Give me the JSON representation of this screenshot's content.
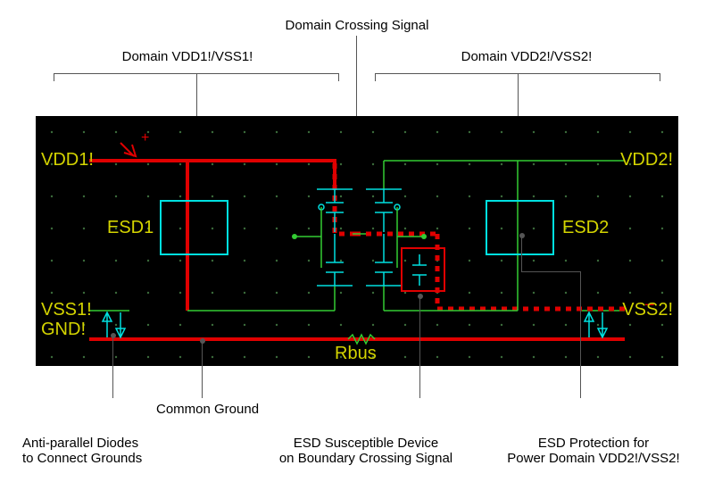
{
  "top_callouts": {
    "domain_crossing": "Domain Crossing Signal",
    "domain1": "Domain VDD1!/VSS1!",
    "domain2": "Domain VDD2!/VSS2!"
  },
  "schematic_labels": {
    "vdd1": "VDD1!",
    "vdd2": "VDD2!",
    "vss1": "VSS1!",
    "vss2": "VSS2!",
    "gnd": "GND!",
    "esd1": "ESD1",
    "esd2": "ESD2",
    "rbus": "Rbus",
    "plus_zap": "+"
  },
  "bottom_callouts": {
    "antiparallel_l1": "Anti-parallel Diodes",
    "antiparallel_l2": "to Connect Grounds",
    "common_ground": "Common Ground",
    "susceptible_l1": "ESD Susceptible Device",
    "susceptible_l2": "on Boundary Crossing Signal",
    "protection_l1": "ESD Protection for",
    "protection_l2": "Power Domain VDD2!/VSS2!"
  }
}
